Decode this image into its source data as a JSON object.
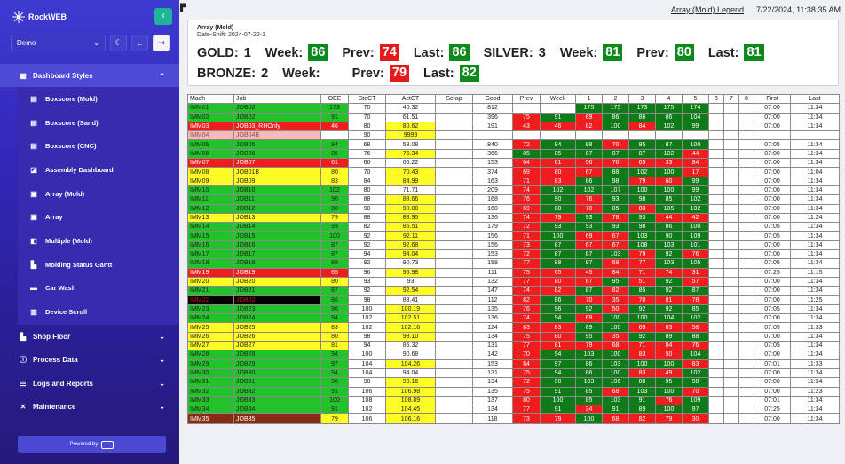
{
  "app": {
    "brand": "RockWEB",
    "collapse_icon": "chevron-left-icon"
  },
  "controls": {
    "plant": "Demo"
  },
  "sidebar": {
    "groups": [
      {
        "label": "Dashboard Styles",
        "icon": "layout-icon",
        "expanded": true
      },
      {
        "label": "Shop Floor",
        "icon": "factory-icon"
      },
      {
        "label": "Process Data",
        "icon": "info-icon"
      },
      {
        "label": "Logs and Reports",
        "icon": "list-icon"
      },
      {
        "label": "Maintenance",
        "icon": "tools-icon"
      }
    ],
    "items": [
      "Boxscore (Mold)",
      "Boxscore (Sand)",
      "Boxscore (CNC)",
      "Assembly Dashboard",
      "Array (Mold)",
      "Array",
      "Multiple (Mold)",
      "Molding Status Gantt",
      "Car Wash",
      "Device Scroll"
    ],
    "powered_by": "Powered by"
  },
  "header": {
    "legend_link": "Array (Mold) Legend",
    "datetime": "7/22/2024, 11:38:35 AM"
  },
  "summary": {
    "title": "Array (Mold)",
    "date_shift": "Date-Shift: 2024-07-22-1",
    "gold": {
      "label": "GOLD:",
      "count": "1",
      "week": "86",
      "prev": "74",
      "last": "86"
    },
    "silver": {
      "label": "SILVER:",
      "count": "3",
      "week": "81",
      "prev": "80",
      "last": "81"
    },
    "bronze": {
      "label": "BRONZE:",
      "count": "2",
      "week": "",
      "prev": "79",
      "last": "82"
    },
    "labels": {
      "week": "Week:",
      "prev": "Prev:",
      "last": "Last:"
    }
  },
  "table": {
    "headers": [
      "Mach",
      "Job",
      "OEE",
      "StdCT",
      "ActCT",
      "Scrap",
      "Good",
      "Prev",
      "Week",
      "1",
      "2",
      "3",
      "4",
      "5",
      "6",
      "7",
      "8",
      "First",
      "Last"
    ],
    "rows": [
      [
        "IMM01",
        "JOB02",
        "173",
        "70",
        "40.32",
        "",
        "812",
        "",
        "",
        "175",
        "175",
        "173",
        "175",
        "174",
        "",
        "",
        "",
        "07:00",
        "11:34"
      ],
      [
        "IMM02",
        "JOB02",
        "91",
        "70",
        "61.51",
        "",
        "396",
        "75",
        "91",
        "69",
        "86",
        "86",
        "86",
        "104",
        "",
        "",
        "",
        "07:00",
        "11:34"
      ],
      [
        "IMM03",
        "JOB03_RHOnly",
        "46",
        "80",
        "80.62",
        "",
        "191",
        "43",
        "46",
        "82",
        "100",
        "84",
        "102",
        "99",
        "",
        "",
        "",
        "07:00",
        "11:34"
      ],
      [
        "IMM04",
        "JOB04B",
        "",
        "90",
        "9999",
        "",
        "",
        "",
        "",
        "",
        "",
        "",
        "",
        "",
        "",
        "",
        "",
        "",
        ""
      ],
      [
        "IMM05",
        "JOB05",
        "94",
        "68",
        "58.08",
        "",
        "840",
        "72",
        "94",
        "98",
        "70",
        "85",
        "87",
        "100",
        "",
        "",
        "",
        "07:05",
        "11:34"
      ],
      [
        "IMM06",
        "JOB06",
        "85",
        "76",
        "76.34",
        "",
        "366",
        "85",
        "85",
        "87",
        "87",
        "87",
        "102",
        "44",
        "",
        "",
        "",
        "07:00",
        "11:34"
      ],
      [
        "IMM07",
        "JOB07",
        "61",
        "66",
        "65.22",
        "",
        "153",
        "64",
        "61",
        "56",
        "76",
        "65",
        "33",
        "84",
        "",
        "",
        "",
        "07:00",
        "11:34"
      ],
      [
        "IMM08",
        "JOB01B",
        "80",
        "70",
        "70.43",
        "",
        "374",
        "69",
        "80",
        "67",
        "88",
        "102",
        "100",
        "17",
        "",
        "",
        "",
        "07:00",
        "11:04"
      ],
      [
        "IMM09",
        "JOB09",
        "83",
        "84",
        "84.99",
        "",
        "163",
        "71",
        "83",
        "86",
        "98",
        "79",
        "60",
        "99",
        "",
        "",
        "",
        "07:00",
        "11:34"
      ],
      [
        "IMM10",
        "JOB10",
        "102",
        "80",
        "71.71",
        "",
        "209",
        "74",
        "102",
        "102",
        "107",
        "100",
        "100",
        "99",
        "",
        "",
        "",
        "07:00",
        "11:34"
      ],
      [
        "IMM11",
        "JOB11",
        "90",
        "88",
        "88.66",
        "",
        "168",
        "76",
        "90",
        "76",
        "93",
        "98",
        "85",
        "102",
        "",
        "",
        "",
        "07:00",
        "11:34"
      ],
      [
        "IMM12",
        "JOB12",
        "88",
        "90",
        "90.08",
        "",
        "160",
        "69",
        "88",
        "70",
        "85",
        "83",
        "105",
        "102",
        "",
        "",
        "",
        "07:00",
        "11:34"
      ],
      [
        "IMM13",
        "JOB13",
        "79",
        "88",
        "88.95",
        "",
        "136",
        "74",
        "79",
        "93",
        "78",
        "93",
        "44",
        "42",
        "",
        "",
        "",
        "07:00",
        "11:24"
      ],
      [
        "IMM14",
        "JOB14",
        "93",
        "82",
        "85.51",
        "",
        "179",
        "72",
        "93",
        "93",
        "93",
        "98",
        "86",
        "100",
        "",
        "",
        "",
        "07:05",
        "11:34"
      ],
      [
        "IMM15",
        "JOB15",
        "100",
        "92",
        "92.11",
        "",
        "156",
        "71",
        "100",
        "69",
        "67",
        "103",
        "90",
        "109",
        "",
        "",
        "",
        "07:05",
        "11:34"
      ],
      [
        "IMM16",
        "JOB16",
        "87",
        "92",
        "92.68",
        "",
        "156",
        "73",
        "87",
        "67",
        "67",
        "108",
        "103",
        "101",
        "",
        "",
        "",
        "07:00",
        "11:34"
      ],
      [
        "IMM17",
        "JOB17",
        "87",
        "94",
        "94.04",
        "",
        "153",
        "72",
        "87",
        "87",
        "103",
        "79",
        "92",
        "76",
        "",
        "",
        "",
        "07:00",
        "11:34"
      ],
      [
        "IMM18",
        "JOB18",
        "89",
        "92",
        "90.73",
        "",
        "158",
        "77",
        "88",
        "97",
        "69",
        "77",
        "103",
        "105",
        "",
        "",
        "",
        "07:05",
        "11:34"
      ],
      [
        "IMM19",
        "JOB19",
        "65",
        "96",
        "96.98",
        "",
        "111",
        "75",
        "65",
        "45",
        "84",
        "71",
        "74",
        "31",
        "",
        "",
        "",
        "07:25",
        "11:15"
      ],
      [
        "IMM20",
        "JOB20",
        "80",
        "93",
        "93",
        "",
        "132",
        "77",
        "80",
        "67",
        "95",
        "51",
        "92",
        "57",
        "",
        "",
        "",
        "07:00",
        "11:34"
      ],
      [
        "IMM21",
        "JOB21",
        "87",
        "92",
        "92.54",
        "",
        "147",
        "74",
        "82",
        "87",
        "82",
        "85",
        "92",
        "87",
        "",
        "",
        "",
        "07:00",
        "11:34"
      ],
      [
        "IMM22",
        "JOB22",
        "86",
        "98",
        "88.41",
        "",
        "112",
        "82",
        "86",
        "70",
        "35",
        "70",
        "81",
        "78",
        "",
        "",
        "",
        "07:00",
        "11:25"
      ],
      [
        "IMM23",
        "JOB23",
        "96",
        "100",
        "100.19",
        "",
        "135",
        "76",
        "96",
        "92",
        "50",
        "92",
        "92",
        "85",
        "",
        "",
        "",
        "07:05",
        "11:34"
      ],
      [
        "IMM24",
        "JOB24",
        "94",
        "102",
        "102.51",
        "",
        "136",
        "74",
        "94",
        "69",
        "100",
        "100",
        "104",
        "102",
        "",
        "",
        "",
        "07:00",
        "11:34"
      ],
      [
        "IMM25",
        "JOB25",
        "83",
        "102",
        "102.16",
        "",
        "124",
        "83",
        "83",
        "89",
        "100",
        "69",
        "63",
        "58",
        "",
        "",
        "",
        "07:05",
        "11:33"
      ],
      [
        "IMM26",
        "JOB26",
        "80",
        "98",
        "98.10",
        "",
        "134",
        "75",
        "80",
        "95",
        "35",
        "92",
        "89",
        "88",
        "",
        "",
        "",
        "07:00",
        "11:34"
      ],
      [
        "IMM27",
        "JOB27",
        "81",
        "94",
        "85.32",
        "",
        "131",
        "77",
        "81",
        "79",
        "68",
        "71",
        "84",
        "76",
        "",
        "",
        "",
        "07:05",
        "11:34"
      ],
      [
        "IMM28",
        "JOB28",
        "94",
        "100",
        "90.68",
        "",
        "142",
        "70",
        "94",
        "103",
        "100",
        "83",
        "50",
        "104",
        "",
        "",
        "",
        "07:00",
        "11:34"
      ],
      [
        "IMM29",
        "JOB29",
        "97",
        "104",
        "104.26",
        "",
        "153",
        "84",
        "97",
        "86",
        "103",
        "100",
        "100",
        "83",
        "",
        "",
        "",
        "07:01",
        "11:33"
      ],
      [
        "IMM30",
        "JOB30",
        "94",
        "104",
        "94.04",
        "",
        "131",
        "75",
        "94",
        "86",
        "100",
        "83",
        "49",
        "102",
        "",
        "",
        "",
        "07:00",
        "11:34"
      ],
      [
        "IMM31",
        "JOB31",
        "98",
        "98",
        "98.16",
        "",
        "134",
        "72",
        "98",
        "103",
        "106",
        "88",
        "95",
        "98",
        "",
        "",
        "",
        "07:00",
        "11:34"
      ],
      [
        "IMM32",
        "JOB32",
        "91",
        "106",
        "106.98",
        "",
        "135",
        "75",
        "91",
        "85",
        "68",
        "103",
        "100",
        "70",
        "",
        "",
        "",
        "07:00",
        "11:23"
      ],
      [
        "IMM33",
        "JOB33",
        "100",
        "108",
        "108.89",
        "",
        "137",
        "80",
        "100",
        "85",
        "103",
        "91",
        "76",
        "109",
        "",
        "",
        "",
        "07:01",
        "11:34"
      ],
      [
        "IMM34",
        "JOB34",
        "91",
        "102",
        "104.45",
        "",
        "134",
        "77",
        "91",
        "34",
        "91",
        "89",
        "100",
        "97",
        "",
        "",
        "",
        "07:25",
        "11:34"
      ],
      [
        "IMM35",
        "JOB35",
        "79",
        "106",
        "106.16",
        "",
        "118",
        "73",
        "79",
        "100",
        "68",
        "82",
        "79",
        "30",
        "",
        "",
        "",
        "07:00",
        "11:34"
      ]
    ]
  },
  "colors": {
    "green": "#22c32a",
    "yellow": "#fffb24",
    "red": "#ef1d1d",
    "dark_green": "#0f7a18",
    "sidebar": "#3226b8",
    "accent": "#1fb39a"
  }
}
